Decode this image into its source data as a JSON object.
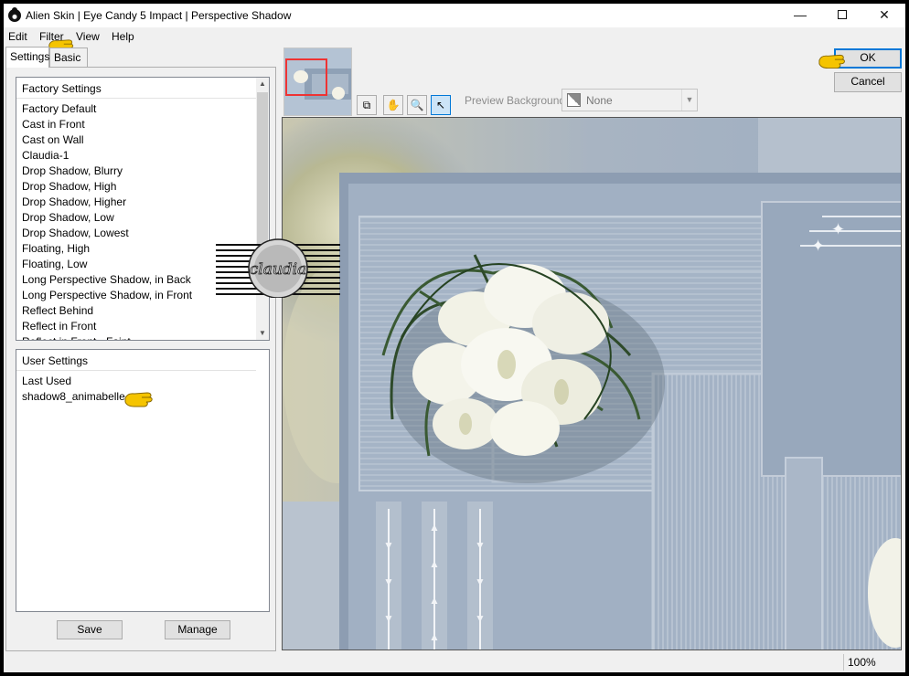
{
  "window": {
    "title": "Alien Skin | Eye Candy 5 Impact | Perspective Shadow",
    "icons": {
      "app": "alien-skin-icon",
      "minimize": "minimize-icon",
      "maximize": "maximize-icon",
      "close": "close-icon"
    }
  },
  "menu": {
    "items": [
      {
        "label": "Edit"
      },
      {
        "label": "Filter"
      },
      {
        "label": "View"
      },
      {
        "label": "Help"
      }
    ]
  },
  "tabs": [
    {
      "label": "Settings",
      "active": true
    },
    {
      "label": "Basic",
      "active": false
    }
  ],
  "factory_settings": {
    "header": "Factory Settings",
    "items": [
      "Factory Default",
      "Cast in Front",
      "Cast on Wall",
      "Claudia-1",
      "Drop Shadow, Blurry",
      "Drop Shadow, High",
      "Drop Shadow, Higher",
      "Drop Shadow, Low",
      "Drop Shadow, Lowest",
      "Floating, High",
      "Floating, Low",
      "Long Perspective Shadow, in Back",
      "Long Perspective Shadow, in Front",
      "Reflect Behind",
      "Reflect in Front",
      "Reflect in Front - Faint"
    ]
  },
  "user_settings": {
    "header": "User Settings",
    "items": [
      {
        "label": "Last Used",
        "selected": false
      },
      {
        "label": "shadow8_animabelle",
        "selected": true
      }
    ]
  },
  "buttons": {
    "save": "Save",
    "manage": "Manage",
    "ok": "OK",
    "cancel": "Cancel"
  },
  "preview_toolbar": {
    "tools": [
      {
        "name": "preview-toggle-icon",
        "glyph": "⧉"
      },
      {
        "name": "hand-icon",
        "glyph": "✋"
      },
      {
        "name": "zoom-icon",
        "glyph": "🔍"
      },
      {
        "name": "arrow-pointer-icon",
        "glyph": "↖"
      }
    ],
    "background_label": "Preview Background:",
    "background_value": "None"
  },
  "watermark_text": "claudia",
  "status": {
    "zoom": "100%"
  },
  "colors": {
    "selection": "#3399ff",
    "pointer_hand": "#f5c400",
    "navigator_box": "#e33333"
  }
}
